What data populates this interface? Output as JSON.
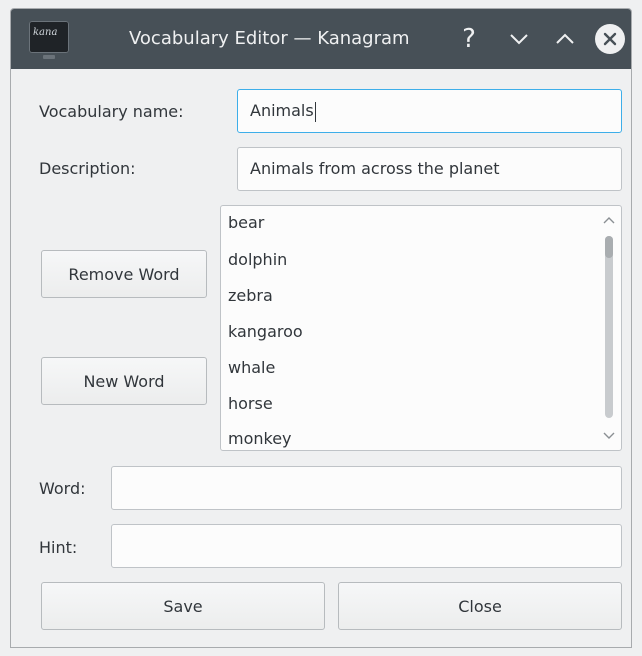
{
  "window": {
    "title": "Vocabulary Editor — Kanagram",
    "app_icon_text": "kana",
    "controls": [
      "help-icon",
      "minimize-icon",
      "maximize-icon",
      "close-icon"
    ]
  },
  "form": {
    "vocab_name_label": "Vocabulary name:",
    "vocab_name_value": "Animals",
    "description_label": "Description:",
    "description_value": "Animals from across the planet",
    "word_label": "Word:",
    "word_value": "",
    "hint_label": "Hint:",
    "hint_value": ""
  },
  "buttons": {
    "remove_word": "Remove Word",
    "new_word": "New Word",
    "save": "Save",
    "close": "Close"
  },
  "words": [
    "bear",
    "dolphin",
    "zebra",
    "kangaroo",
    "whale",
    "horse",
    "monkey"
  ],
  "colors": {
    "titlebar": "#475057",
    "background": "#eff0f1",
    "focus_accent": "#3daee9"
  }
}
